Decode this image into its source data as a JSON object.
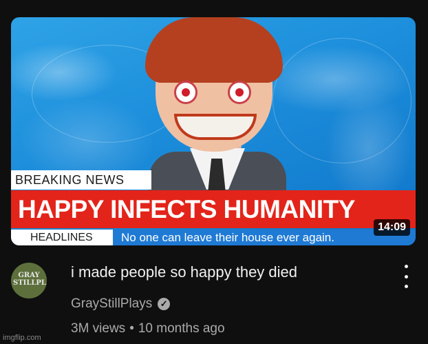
{
  "thumbnail": {
    "breaking_label": "BREAKING NEWS",
    "headline": "HAPPY INFECTS HUMANITY",
    "headlines_tag": "HEADLINES",
    "ticker": "No one can leave their house ever again.",
    "duration": "14:09"
  },
  "video": {
    "title": "i made people so happy they died",
    "channel": "GrayStillPlays",
    "verified_icon": "checkmark-circle-icon",
    "views": "3M views",
    "separator": "•",
    "age": "10 months ago"
  },
  "avatar_text": "GRAY STILLPLAYS",
  "menu_icon": "more-vertical-icon",
  "watermark": "imgflip.com",
  "colors": {
    "background": "#0f0f0f",
    "banner_red": "#e3241a",
    "banner_blue": "#1f7ad4",
    "secondary_text": "#aaaaaa"
  }
}
